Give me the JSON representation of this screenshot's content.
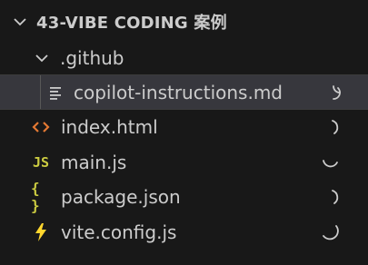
{
  "explorer": {
    "folder_title": "43-VIBE CODING 案例",
    "subfolder": ".github",
    "selected_file": "copilot-instructions.md",
    "files": [
      {
        "name": "index.html",
        "icon": "html-icon",
        "icon_text": "<>",
        "icon_color": "#e37933"
      },
      {
        "name": "main.js",
        "icon": "javascript-icon",
        "icon_text": "JS",
        "icon_color": "#cbcb41"
      },
      {
        "name": "package.json",
        "icon": "json-icon",
        "icon_text": "{ }",
        "icon_color": "#cbcb41"
      },
      {
        "name": "vite.config.js",
        "icon": "vite-icon",
        "icon_text": "",
        "icon_color": "#ffd62e"
      }
    ]
  },
  "colors": {
    "background": "#181818",
    "selected_row": "#37373d",
    "text": "#cccccc",
    "spinner": "#cccccc"
  }
}
